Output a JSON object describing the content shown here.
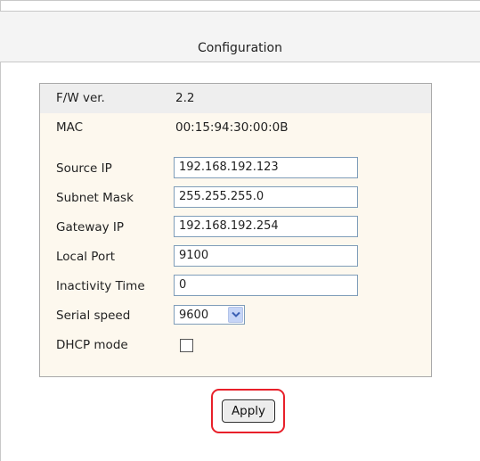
{
  "header": {
    "title": "Configuration"
  },
  "config": {
    "fw_version": {
      "label": "F/W ver.",
      "value": "2.2"
    },
    "mac": {
      "label": "MAC",
      "value": "00:15:94:30:00:0B"
    },
    "source_ip": {
      "label": "Source IP",
      "value": "192.168.192.123"
    },
    "subnet_mask": {
      "label": "Subnet Mask",
      "value": "255.255.255.0"
    },
    "gateway_ip": {
      "label": "Gateway IP",
      "value": "192.168.192.254"
    },
    "local_port": {
      "label": "Local Port",
      "value": "9100"
    },
    "inactivity_time": {
      "label": "Inactivity Time",
      "value": "0"
    },
    "serial_speed": {
      "label": "Serial speed",
      "value": "9600",
      "options": [
        "9600"
      ]
    },
    "dhcp_mode": {
      "label": "DHCP mode",
      "checked": false
    }
  },
  "actions": {
    "apply_label": "Apply"
  },
  "colors": {
    "highlight": "#e8202a",
    "panel_bg": "#fdf8ee",
    "header_row_bg": "#eeeeee"
  },
  "icons": {
    "select_arrow": "chevron-down-icon"
  }
}
